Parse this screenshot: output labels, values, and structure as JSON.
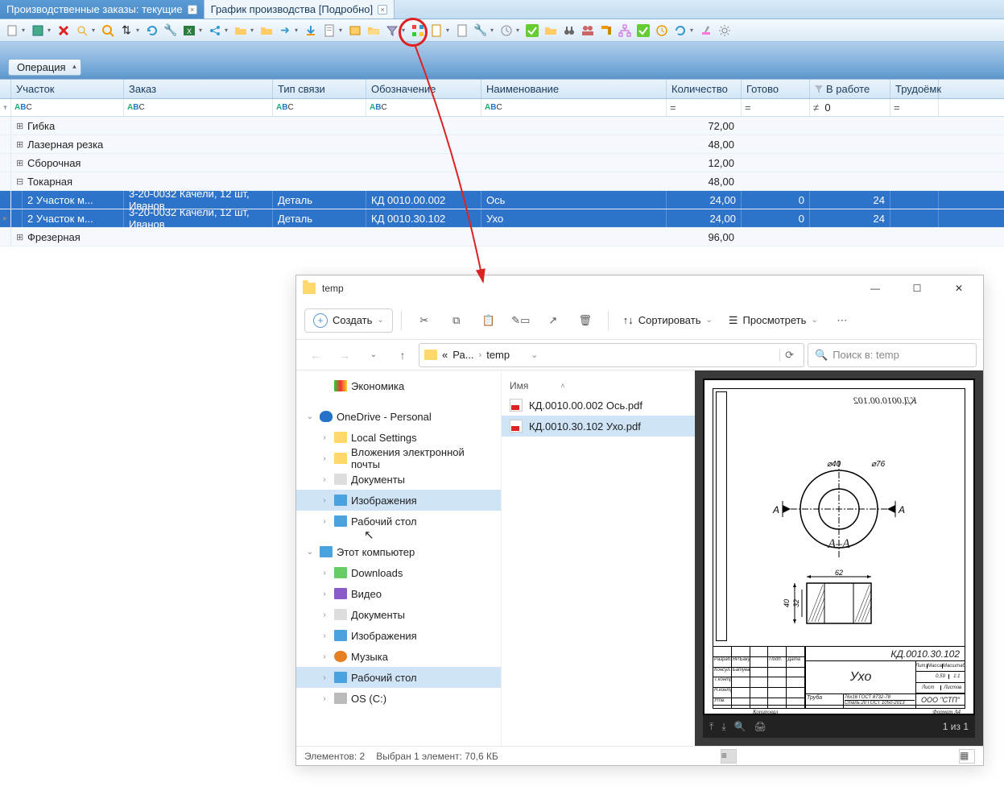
{
  "tabs": [
    {
      "label": "Производственные заказы: текущие",
      "active": false
    },
    {
      "label": "График производства [Подробно]",
      "active": true
    }
  ],
  "operation_btn": "Операция",
  "columns": {
    "uchastok": "Участок",
    "zakaz": "Заказ",
    "tip": "Тип связи",
    "oboznachenie": "Обозначение",
    "naimenovanie": "Наименование",
    "kolichestvo": "Количество",
    "gotovo": "Готово",
    "vrabote": "В работе",
    "trudoemk": "Трудоёмк"
  },
  "filter_zero": "0",
  "groups": [
    {
      "name": "Гибка",
      "qty": "72,00",
      "expanded": false
    },
    {
      "name": "Лазерная резка",
      "qty": "48,00",
      "expanded": false
    },
    {
      "name": "Сборочная",
      "qty": "12,00",
      "expanded": false
    },
    {
      "name": "Токарная",
      "qty": "48,00",
      "expanded": true,
      "rows": [
        {
          "uch": "2 Участок м...",
          "zak": "3-20-0032 Качели, 12 шт, Иванов",
          "tip": "Деталь",
          "obz": "КД 0010.00.002",
          "nam": "Ось",
          "kol": "24,00",
          "got": "0",
          "rab": "24"
        },
        {
          "uch": "2 Участок м...",
          "zak": "3-20-0032 Качели, 12 шт, Иванов",
          "tip": "Деталь",
          "obz": "КД 0010.30.102",
          "nam": "Ухо",
          "kol": "24,00",
          "got": "0",
          "rab": "24"
        }
      ]
    },
    {
      "name": "Фрезерная",
      "qty": "96,00",
      "expanded": false
    }
  ],
  "explorer": {
    "title": "temp",
    "create": "Создать",
    "sort": "Сортировать",
    "view": "Просмотреть",
    "breadcrumb": {
      "ellipsis": "«",
      "p1": "Ра...",
      "p2": "temp"
    },
    "search_placeholder": "Поиск в: temp",
    "tree": [
      {
        "indent": 1,
        "chev": "",
        "icon": "econ",
        "label": "Экономика"
      },
      {
        "indent": 0,
        "chev": "⌄",
        "icon": "cloud",
        "label": "OneDrive - Personal"
      },
      {
        "indent": 1,
        "chev": "›",
        "icon": "fold",
        "label": "Local Settings"
      },
      {
        "indent": 1,
        "chev": "›",
        "icon": "fold",
        "label": "Вложения электронной почты"
      },
      {
        "indent": 1,
        "chev": "›",
        "icon": "doc",
        "label": "Документы"
      },
      {
        "indent": 1,
        "chev": "›",
        "icon": "img",
        "label": "Изображения",
        "sel": true
      },
      {
        "indent": 1,
        "chev": "›",
        "icon": "pc",
        "label": "Рабочий стол"
      },
      {
        "indent": 0,
        "chev": "⌄",
        "icon": "pc",
        "label": "Этот компьютер"
      },
      {
        "indent": 1,
        "chev": "›",
        "icon": "dl",
        "label": "Downloads"
      },
      {
        "indent": 1,
        "chev": "›",
        "icon": "vid",
        "label": "Видео"
      },
      {
        "indent": 1,
        "chev": "›",
        "icon": "doc",
        "label": "Документы"
      },
      {
        "indent": 1,
        "chev": "›",
        "icon": "img",
        "label": "Изображения"
      },
      {
        "indent": 1,
        "chev": "›",
        "icon": "mus",
        "label": "Музыка"
      },
      {
        "indent": 1,
        "chev": "›",
        "icon": "pc",
        "label": "Рабочий стол",
        "sel2": true
      },
      {
        "indent": 1,
        "chev": "›",
        "icon": "disk",
        "label": "OS (C:)"
      }
    ],
    "files_header": "Имя",
    "files": [
      {
        "name": "КД.0010.00.002 Ось.pdf",
        "sel": false
      },
      {
        "name": "КД.0010.30.102 Ухо.pdf",
        "sel": true
      }
    ],
    "status": {
      "elements": "Элементов: 2",
      "selected": "Выбран 1 элемент: 70,6 КБ"
    },
    "preview": {
      "kd_top": "КД.0010.00.102",
      "d1": "⌀40",
      "d2": "⌀76",
      "arrow_l": "А",
      "arrow_r": "А",
      "section": "А–А",
      "dim_w": "62",
      "dim_h": "40",
      "dim_h2": "32",
      "kd": "КД.0010.30.102",
      "part": "Ухо",
      "mass": "0,59",
      "scale": "1:1",
      "lit": "Лит.",
      "massl": "Масса",
      "scalel": "Масштаб",
      "gost1": "76x16 ГОСТ 8732-78",
      "gost2": "Сталь 20 ГОСТ 1050-2013",
      "truba": "Труба",
      "company": "ООО \"СТП\"",
      "list": "Лист",
      "listov": "Листов",
      "format": "Формат    А4",
      "pages": "1 из 1"
    }
  }
}
